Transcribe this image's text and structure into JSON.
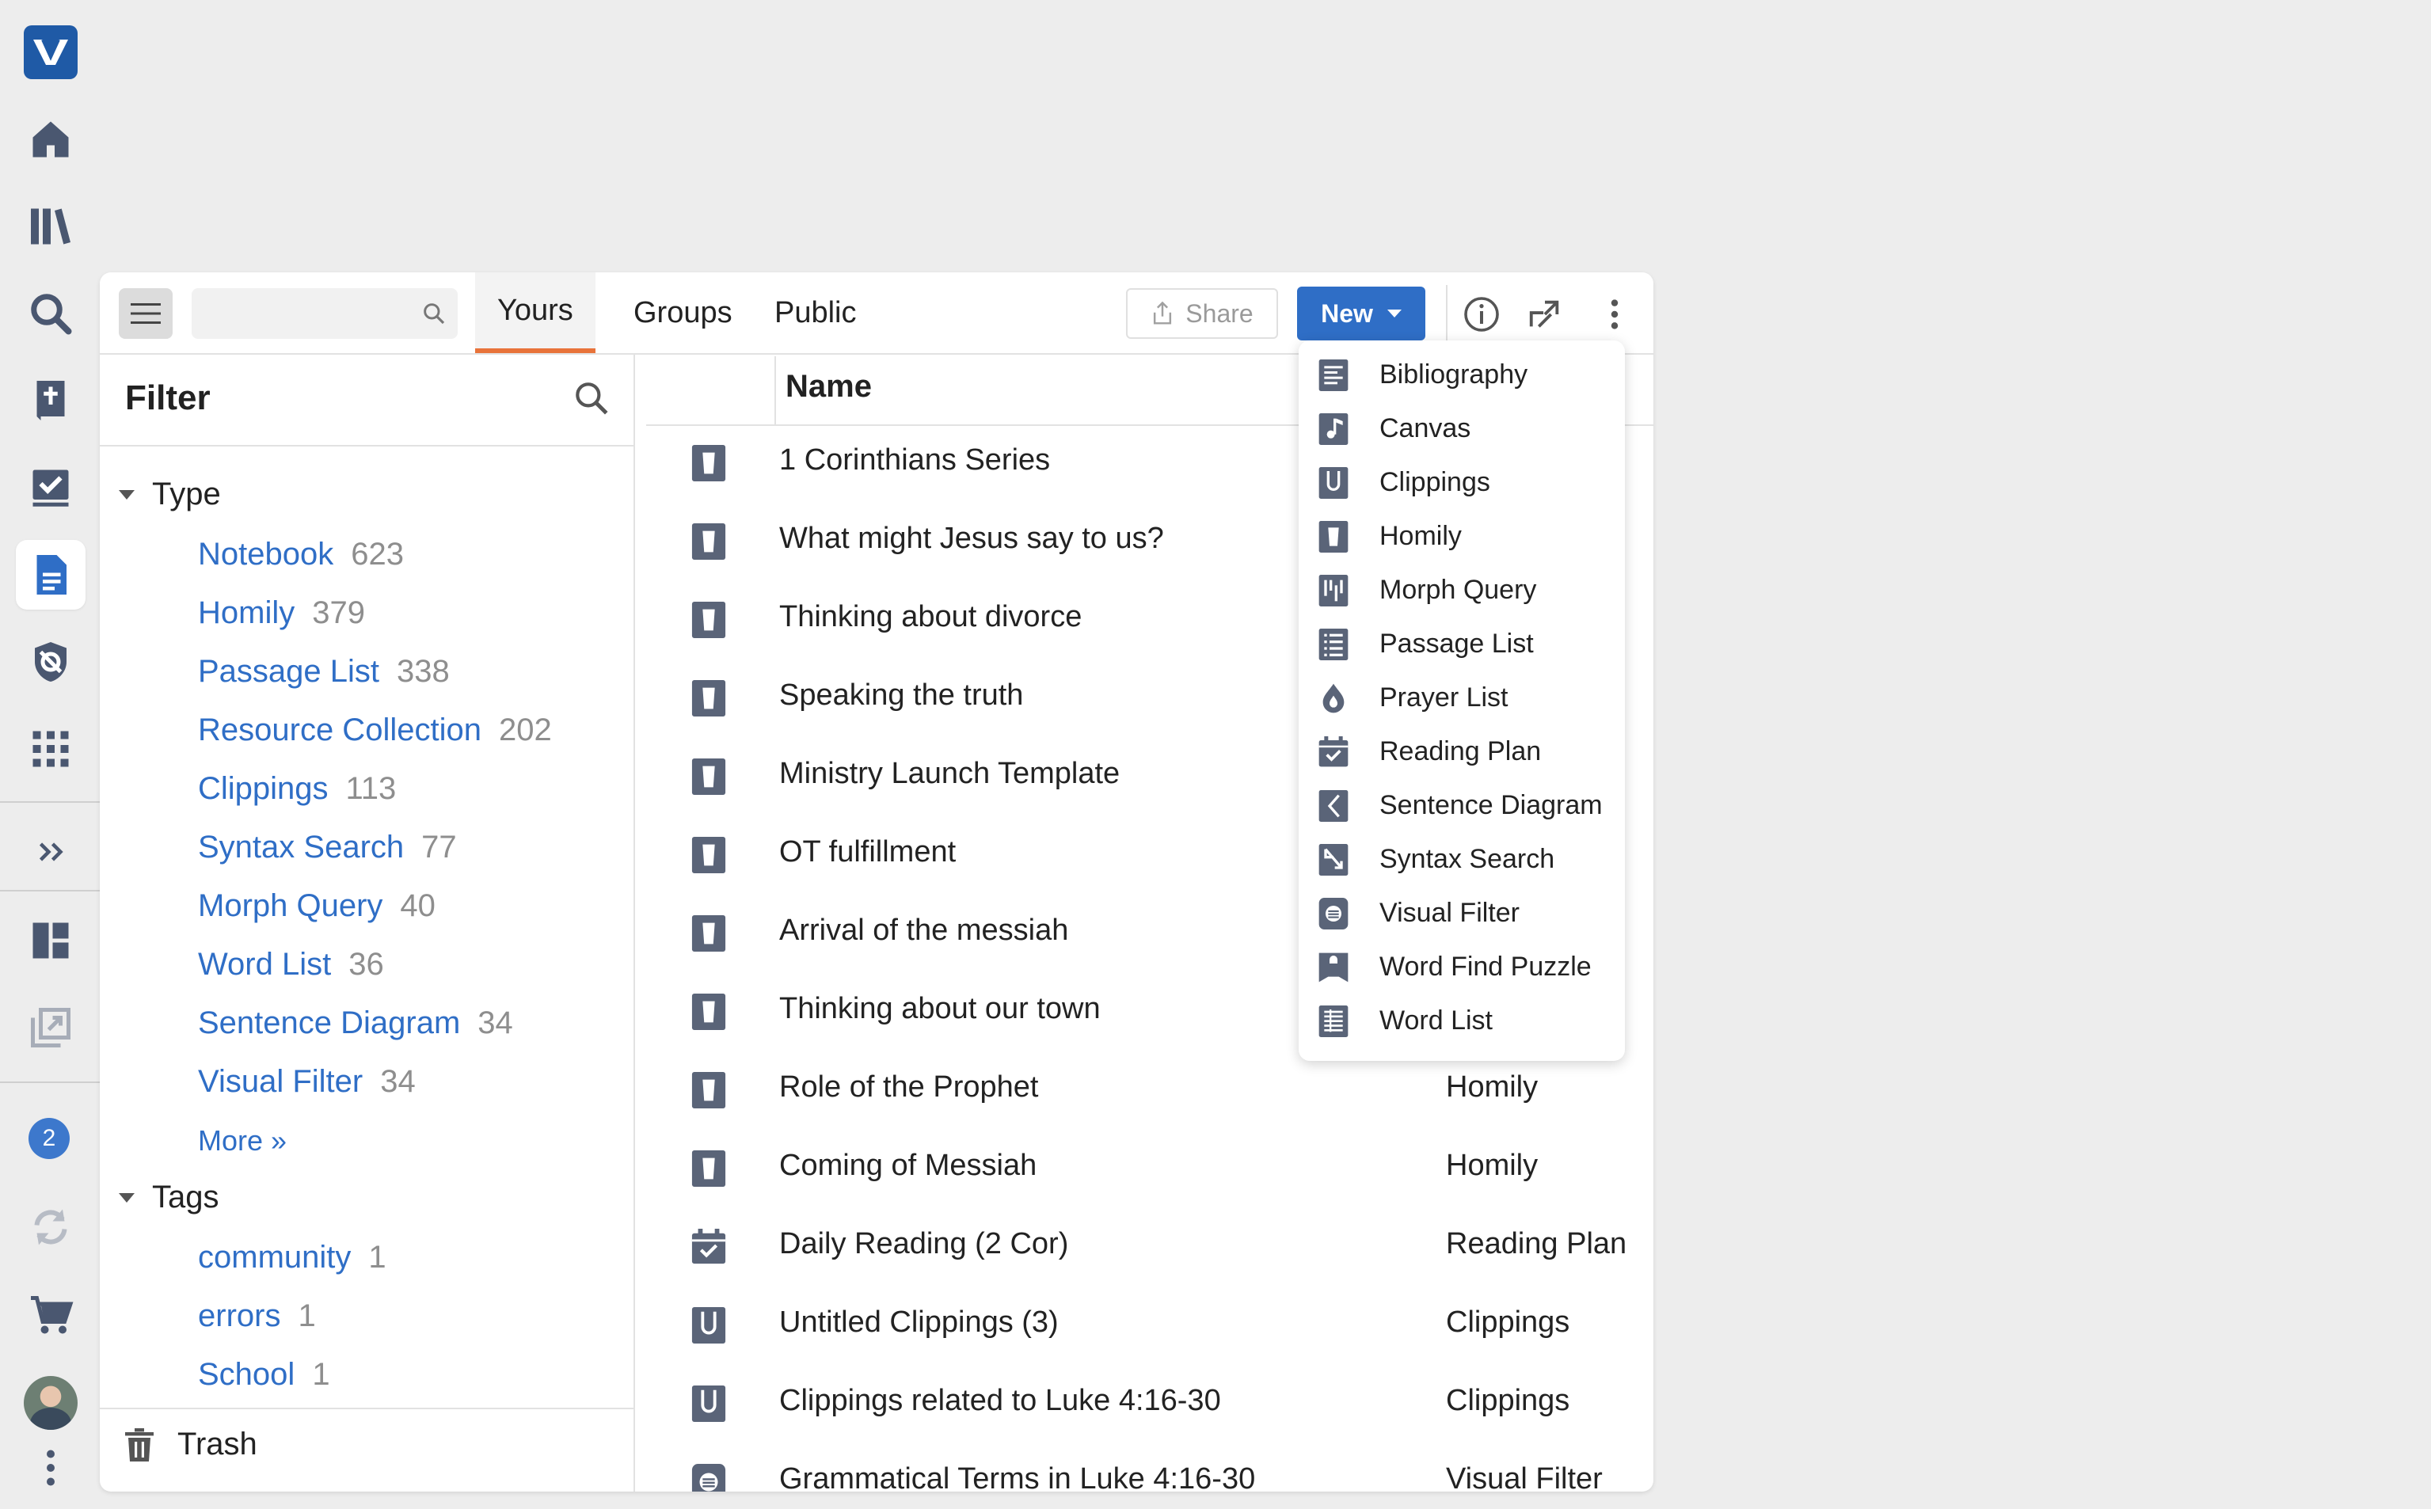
{
  "colors": {
    "accent": "#2f6ec6",
    "tab_underline": "#e8733a",
    "icon": "#5a6478",
    "rail_icon": "#4a5770"
  },
  "rail": {
    "icons": [
      "logos-logo-icon",
      "home-icon",
      "library-icon",
      "search-icon",
      "bible-icon",
      "checklist-icon",
      "documents-icon",
      "settings-shield-icon",
      "apps-grid-icon",
      "expand-icon",
      "layouts-icon",
      "closed-panels-icon",
      "notifications-badge",
      "sync-icon",
      "cart-icon",
      "user-avatar",
      "more-vertical-icon"
    ],
    "notification_count": "2"
  },
  "toolbar": {
    "search_placeholder": "",
    "tabs": [
      "Yours",
      "Groups",
      "Public"
    ],
    "active_tab": "Yours",
    "share_label": "Share",
    "new_label": "New"
  },
  "filter": {
    "title": "Filter",
    "type_heading": "Type",
    "types": [
      {
        "label": "Notebook",
        "count": "623"
      },
      {
        "label": "Homily",
        "count": "379"
      },
      {
        "label": "Passage List",
        "count": "338"
      },
      {
        "label": "Resource Collection",
        "count": "202"
      },
      {
        "label": "Clippings",
        "count": "113"
      },
      {
        "label": "Syntax Search",
        "count": "77"
      },
      {
        "label": "Morph Query",
        "count": "40"
      },
      {
        "label": "Word List",
        "count": "36"
      },
      {
        "label": "Sentence Diagram",
        "count": "34"
      },
      {
        "label": "Visual Filter",
        "count": "34"
      }
    ],
    "more_label": "More »",
    "tags_heading": "Tags",
    "tags": [
      {
        "label": "community",
        "count": "1"
      },
      {
        "label": "errors",
        "count": "1"
      },
      {
        "label": "School",
        "count": "1"
      }
    ],
    "trash_label": "Trash"
  },
  "list": {
    "name_header": "Name",
    "rows": [
      {
        "name": "1 Corinthians Series",
        "type": "",
        "icon": "homily"
      },
      {
        "name": "What might Jesus say to us?",
        "type": "",
        "icon": "homily"
      },
      {
        "name": "Thinking about divorce",
        "type": "",
        "icon": "homily"
      },
      {
        "name": "Speaking the truth",
        "type": "",
        "icon": "homily"
      },
      {
        "name": "Ministry Launch Template",
        "type": "",
        "icon": "homily"
      },
      {
        "name": "OT fulfillment",
        "type": "",
        "icon": "homily"
      },
      {
        "name": "Arrival of the messiah",
        "type": "",
        "icon": "homily"
      },
      {
        "name": "Thinking about our town",
        "type": "",
        "icon": "homily"
      },
      {
        "name": "Role of the Prophet",
        "type": "Homily",
        "icon": "homily"
      },
      {
        "name": "Coming of Messiah",
        "type": "Homily",
        "icon": "homily"
      },
      {
        "name": "Daily Reading (2 Cor)",
        "type": "Reading Plan",
        "icon": "reading-plan"
      },
      {
        "name": "Untitled Clippings (3)",
        "type": "Clippings",
        "icon": "clippings"
      },
      {
        "name": "Clippings related to Luke 4:16-30",
        "type": "Clippings",
        "icon": "clippings"
      },
      {
        "name": "Grammatical Terms in Luke 4:16-30",
        "type": "Visual Filter",
        "icon": "visual-filter"
      }
    ]
  },
  "new_menu": {
    "items": [
      {
        "label": "Bibliography",
        "icon": "bibliography"
      },
      {
        "label": "Canvas",
        "icon": "canvas"
      },
      {
        "label": "Clippings",
        "icon": "clippings"
      },
      {
        "label": "Homily",
        "icon": "homily"
      },
      {
        "label": "Morph Query",
        "icon": "morph-query"
      },
      {
        "label": "Passage List",
        "icon": "passage-list"
      },
      {
        "label": "Prayer List",
        "icon": "prayer-list"
      },
      {
        "label": "Reading Plan",
        "icon": "reading-plan"
      },
      {
        "label": "Sentence Diagram",
        "icon": "sentence-diagram"
      },
      {
        "label": "Syntax Search",
        "icon": "syntax-search"
      },
      {
        "label": "Visual Filter",
        "icon": "visual-filter"
      },
      {
        "label": "Word Find Puzzle",
        "icon": "word-find-puzzle"
      },
      {
        "label": "Word List",
        "icon": "word-list"
      }
    ]
  }
}
